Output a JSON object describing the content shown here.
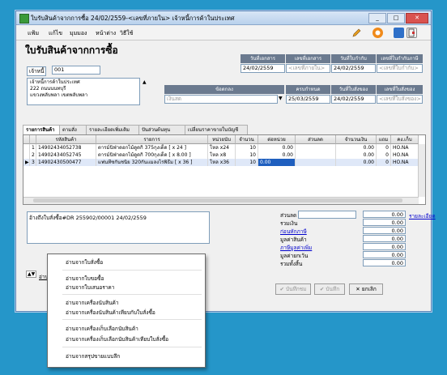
{
  "window": {
    "title": "ใบรับสินค้าจากการซื้อ 24/02/2559-<เลขที่ภายใน> เจ้าหนี้การค้าในประเทศ",
    "min": "_",
    "max": "□",
    "close": "✕"
  },
  "menu": [
    "แฟ้ม",
    "แก้ไข",
    "มุมมอง",
    "หน้าต่าง",
    "วิธีใช้"
  ],
  "form": {
    "title": "ใบรับสินค้าจากการซื้อ",
    "creditor_label": "เจ้าหนี้",
    "creditor_code": "001",
    "creditor_address": [
      "เจ้าหนี้การค้าในประเทศ",
      "222 ถนนนนทบุรี",
      "แขวงพลับพลา เขตพลับพลา"
    ],
    "header_cols": {
      "doc_date": {
        "label": "วันที่เอกสาร",
        "value": "24/02/2559"
      },
      "doc_no": {
        "label": "เลขที่เอกสาร",
        "value": "<เลขที่ภายใน>"
      },
      "tax_date": {
        "label": "วันที่ใบกำกับ",
        "value": "24/02/2559"
      },
      "tax_no": {
        "label": "เลขที่ใบกำกับภาษี",
        "value": "<เลขที่ใบกำกับ>"
      }
    },
    "sub_cols": {
      "terms": {
        "label": "ข้อตกลง",
        "value": "เงินสด"
      },
      "due": {
        "label": "ครบกำหนด",
        "value": "25/03/2559"
      },
      "order_date": {
        "label": "วันที่ใบสั่งของ",
        "value": "24/02/2559"
      },
      "order_no": {
        "label": "เลขที่ใบสั่งของ",
        "value": "<เลขที่ใบสั่งของ>"
      }
    }
  },
  "tabs": [
    "รายการสินค้า",
    "ตามสั่ง",
    "รายละเอียดเพิ่มเติม",
    "ปันส่วนต้นทุน",
    "เปลี่ยนราคาขายในบัญชี"
  ],
  "grid": {
    "headers": [
      "",
      "รหัสสินค้า",
      "รายการ",
      "หน่วยนับ",
      "จำนวน",
      "ต่อหน่วย",
      "ส่วนลด",
      "จำนวนเงิน",
      "แถม",
      "คง.เก็บ"
    ],
    "rows": [
      {
        "sel": "",
        "n": "1",
        "code": "14902434052738",
        "desc": "ตารม์นิฟ่าดอกไม้ดูดกิ 375กุงเด็ด [ x 24 ]",
        "unit": "โหล x24",
        "qty": "10",
        "price": "0.00",
        "disc": "",
        "amount": "0.00",
        "free": "0",
        "wh": "HO.NA"
      },
      {
        "sel": "",
        "n": "2",
        "code": "14902434052745",
        "desc": "ตารม์นิฟ่าดอกไม้ดูดกิ 700กุงเด็ด [ x 8.00 ]",
        "unit": "โหล x8",
        "qty": "10",
        "price": "0.00",
        "disc": "",
        "amount": "0.00",
        "free": "0",
        "wh": "HO.NA"
      },
      {
        "sel": "▶",
        "n": "3",
        "code": "14902430500477",
        "desc": "แฟนทีซกันชนิย 320กันแมลงไรพิธีม [ x 36 ]",
        "unit": "โหล x36",
        "qty": "10",
        "price": "0.00",
        "disc": "",
        "amount": "0.00",
        "free": "0",
        "wh": "HO.NA"
      }
    ]
  },
  "remark": "อ้างถึงใบสั่งซื้อ#DR 255902/00001 24/02/2559",
  "totals": {
    "discount_label": "ส่วนลด",
    "detail_link": "รายละเอียด",
    "rows": [
      {
        "label": "รวมเงิน",
        "value": "0.00",
        "link": false
      },
      {
        "label": "ก่อนหักภาษี",
        "value": "0.00",
        "link": true
      },
      {
        "label": "มูลค่าสินค้า",
        "value": "0.00",
        "link": false
      },
      {
        "label": "ภาษีมูลค่าเพิ่ม",
        "value": "0.00",
        "link": true
      },
      {
        "label": "มูลค่ายกเว้น",
        "value": "0.00",
        "link": false
      },
      {
        "label": "รวมทั้งสิ้น",
        "value": "0.00",
        "link": false
      }
    ],
    "discount_value": "0.00"
  },
  "buttons": {
    "save": "บันทึกชม",
    "record": "บันทึก",
    "cancel": "ยกเลิก"
  },
  "left_small": "อ่าน",
  "popup": [
    "อ่านจากใบสั่งซื้อ",
    "อ่านจากใบขอซื้อ",
    "อ่านจากใบเสนอราคา",
    "อ่านจากเครื่องนับสินค้า",
    "อ่านจากเครื่องนับสินค้าเทียบกับใบสั่งซื้อ",
    "อ่านจากเครื่องเก็บเลือกนับสินค้า",
    "อ่านจากเครื่องเก็บเลือกนับสินค้าเทียบใบสั่งซื้อ",
    "อ่านจากสรุปขายแบบลึก"
  ],
  "colors": {
    "accent": "#2596c9",
    "header_col": "#6b7a8f",
    "selected_row": "#1f5fbf"
  }
}
